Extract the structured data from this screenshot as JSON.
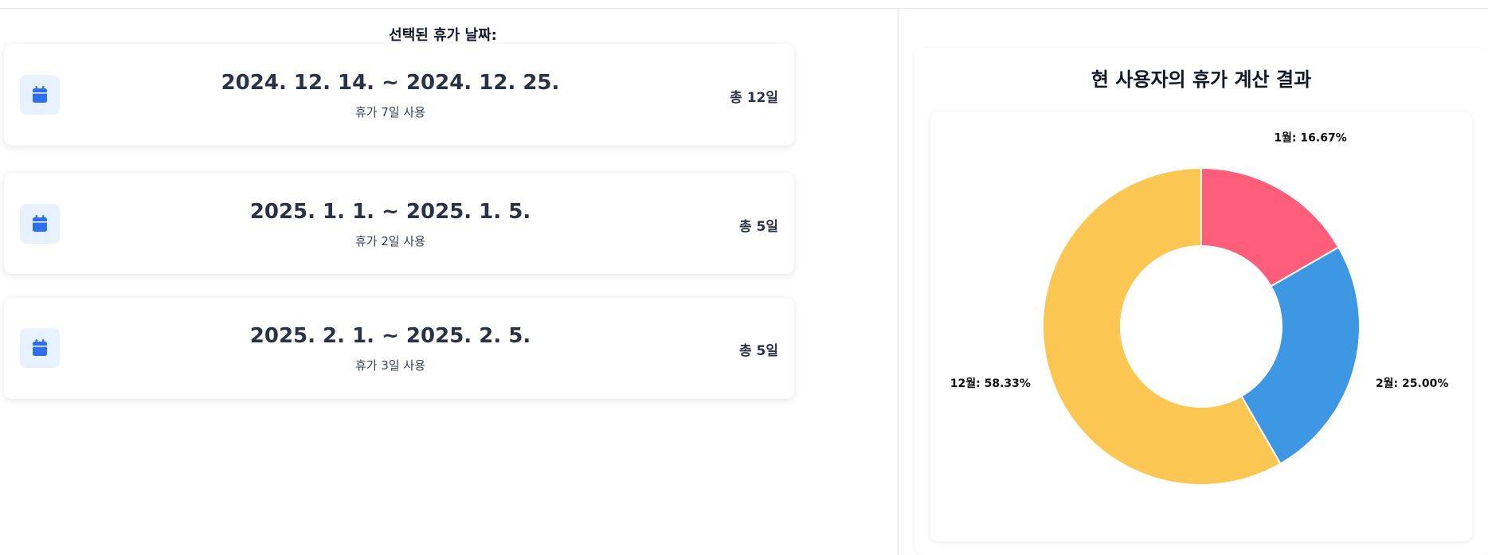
{
  "left": {
    "title": "선택된 휴가 날짜:",
    "vacations": [
      {
        "range": "2024. 12. 14. ~ 2024. 12. 25.",
        "used": "휴가 7일 사용",
        "total": "총 12일"
      },
      {
        "range": "2025. 1. 1. ~ 2025. 1. 5.",
        "used": "휴가 2일 사용",
        "total": "총 5일"
      },
      {
        "range": "2025. 2. 1. ~ 2025. 2. 5.",
        "used": "휴가 3일 사용",
        "total": "총 5일"
      }
    ]
  },
  "right": {
    "title": "현 사용자의 휴가 계산 결과"
  },
  "colors": {
    "accent": "#2f6fed",
    "icon_bg": "#e8f1fe"
  },
  "icons": {
    "card_icon": "calendar-icon"
  },
  "chart_data": {
    "type": "pie",
    "style": "doughnut",
    "slices": [
      {
        "label": "1월: 16.67%",
        "value": 16.67,
        "color": "#ff5e7b"
      },
      {
        "label": "2월: 25.00%",
        "value": 25.0,
        "color": "#3d97e3"
      },
      {
        "label": "12월: 58.33%",
        "value": 58.33,
        "color": "#fcc653"
      }
    ]
  }
}
